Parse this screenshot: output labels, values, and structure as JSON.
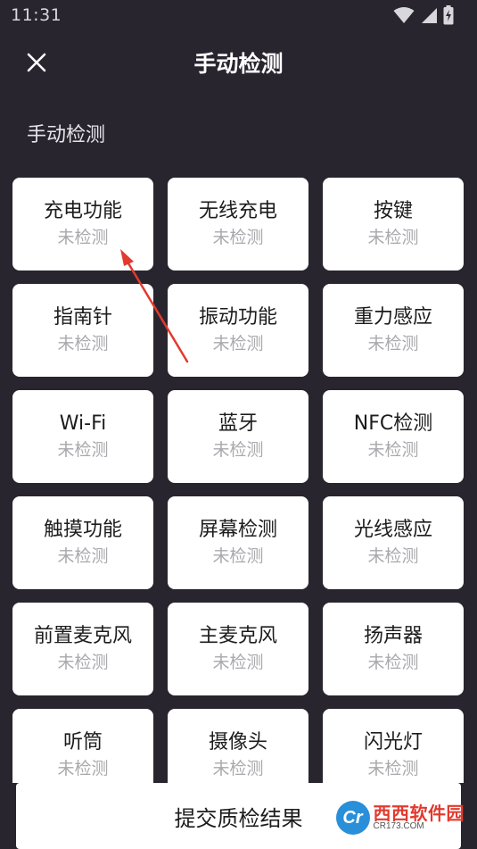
{
  "status_bar": {
    "time": "11:31",
    "icons": [
      "wifi-icon",
      "cellular-signal-icon",
      "battery-charging-icon"
    ]
  },
  "header": {
    "title": "手动检测",
    "close_icon": "close-icon"
  },
  "section_title": "手动检测",
  "items": [
    {
      "name": "充电功能",
      "status": "未检测"
    },
    {
      "name": "无线充电",
      "status": "未检测"
    },
    {
      "name": "按键",
      "status": "未检测"
    },
    {
      "name": "指南针",
      "status": "未检测"
    },
    {
      "name": "振动功能",
      "status": "未检测"
    },
    {
      "name": "重力感应",
      "status": "未检测"
    },
    {
      "name": "Wi-Fi",
      "status": "未检测"
    },
    {
      "name": "蓝牙",
      "status": "未检测"
    },
    {
      "name": "NFC检测",
      "status": "未检测"
    },
    {
      "name": "触摸功能",
      "status": "未检测"
    },
    {
      "name": "屏幕检测",
      "status": "未检测"
    },
    {
      "name": "光线感应",
      "status": "未检测"
    },
    {
      "name": "前置麦克风",
      "status": "未检测"
    },
    {
      "name": "主麦克风",
      "status": "未检测"
    },
    {
      "name": "扬声器",
      "status": "未检测"
    },
    {
      "name": "听筒",
      "status": "未检测"
    },
    {
      "name": "摄像头",
      "status": "未检测"
    },
    {
      "name": "闪光灯",
      "status": "未检测"
    }
  ],
  "submit_label": "提交质检结果",
  "watermark": {
    "logo_text": "Cr",
    "text": "西西软件园",
    "url": "CR173.COM"
  },
  "colors": {
    "background": "#28252f",
    "card": "#ffffff",
    "annotation_arrow": "#e23a2e"
  }
}
